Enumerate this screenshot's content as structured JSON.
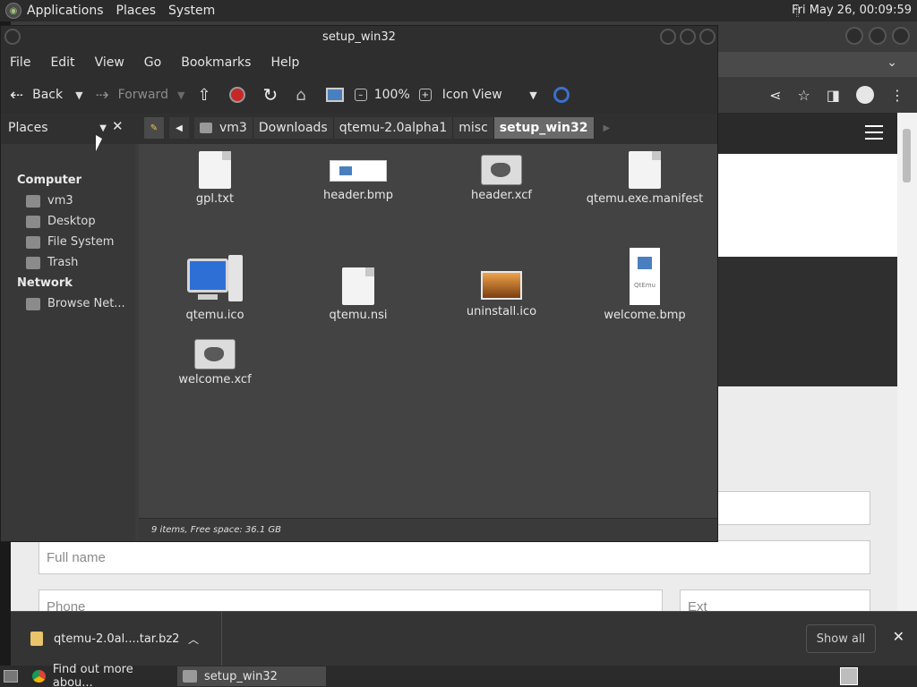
{
  "top_panel": {
    "menus": [
      "Applications",
      "Places",
      "System"
    ],
    "clock": "Fri May 26, 00:09:59"
  },
  "file_manager": {
    "title": "setup_win32",
    "menu": [
      "File",
      "Edit",
      "View",
      "Go",
      "Bookmarks",
      "Help"
    ],
    "toolbar": {
      "back": "Back",
      "forward": "Forward",
      "zoom": "100%",
      "view_mode": "Icon View"
    },
    "places_label": "Places",
    "breadcrumbs": [
      "vm3",
      "Downloads",
      "qtemu-2.0alpha1",
      "misc",
      "setup_win32"
    ],
    "sidebar": {
      "computer_header": "Computer",
      "computer_items": [
        "vm3",
        "Desktop",
        "File System",
        "Trash"
      ],
      "network_header": "Network",
      "network_items": [
        "Browse Net..."
      ]
    },
    "files": [
      "gpl.txt",
      "header.bmp",
      "header.xcf",
      "qtemu.exe.manifest",
      "qtemu.ico",
      "qtemu.nsi",
      "uninstall.ico",
      "welcome.bmp",
      "welcome.xcf"
    ],
    "welcome_bmp_text": "QtEmu",
    "status": "9 items, Free space: 36.1 GB"
  },
  "browser": {
    "form": {
      "full_name_placeholder": "Full name",
      "phone_placeholder": "Phone",
      "ext_placeholder": "Ext"
    },
    "download": {
      "filename": "qtemu-2.0al....tar.bz2",
      "show_all": "Show all"
    }
  },
  "taskbar": {
    "tasks": [
      "Find out more abou...",
      "setup_win32"
    ]
  }
}
